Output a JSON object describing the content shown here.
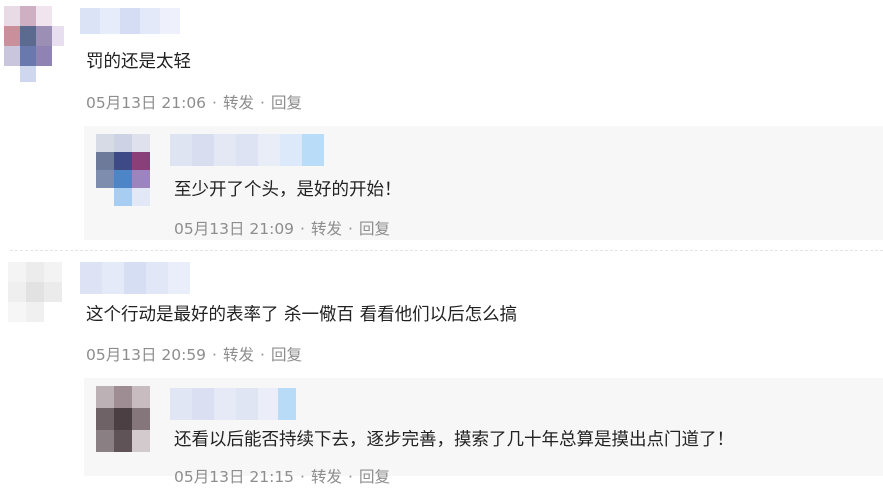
{
  "comments": [
    {
      "text": "罚的还是太轻",
      "time": "05月13日 21:06",
      "separator": "·",
      "forward_label": "转发",
      "reply_label": "回复",
      "reply": {
        "text": "至少开了个头，是好的开始！",
        "time": "05月13日 21:09",
        "separator": "·",
        "forward_label": "转发",
        "reply_label": "回复"
      }
    },
    {
      "text": "这个行动是最好的表率了 杀一儆百 看看他们以后怎么搞",
      "time": "05月13日 20:59",
      "separator": "·",
      "forward_label": "转发",
      "reply_label": "回复",
      "reply": {
        "text": "还看以后能否持续下去，逐步完善，摸索了几十年总算是摸出点门道了！",
        "time": "05月13日 21:15",
        "separator": "·",
        "forward_label": "转发",
        "reply_label": "回复"
      }
    }
  ],
  "colors": {
    "meta_text": "#8d8d8d",
    "body_text": "#222222",
    "reply_background": "#f7f7f7"
  }
}
